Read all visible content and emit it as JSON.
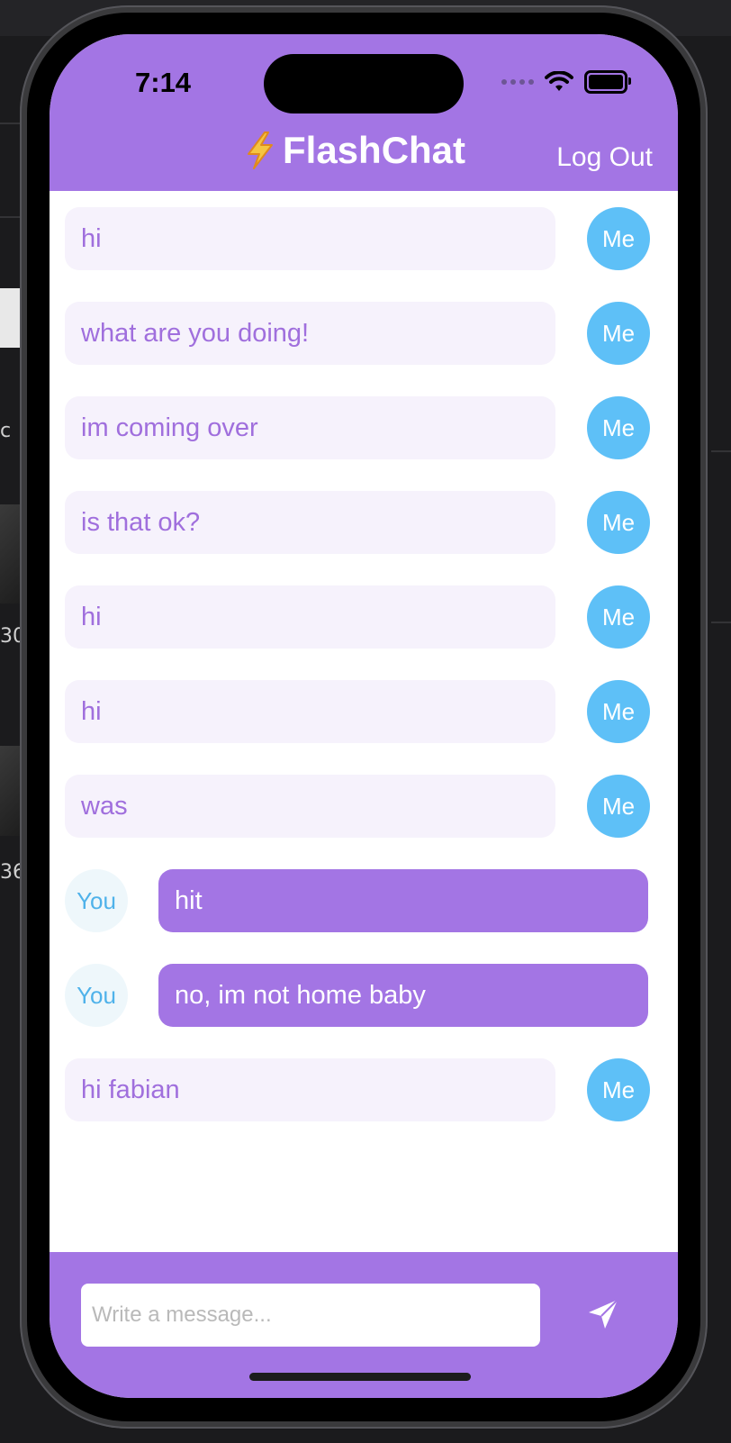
{
  "status_bar": {
    "time": "7:14"
  },
  "header": {
    "title": "FlashChat",
    "logout_label": "Log Out",
    "accent_color": "#a375e4"
  },
  "messages": [
    {
      "sender": "me",
      "text": "hi",
      "avatar": "Me"
    },
    {
      "sender": "me",
      "text": "what are you doing!",
      "avatar": "Me"
    },
    {
      "sender": "me",
      "text": "im coming over",
      "avatar": "Me"
    },
    {
      "sender": "me",
      "text": "is that ok?",
      "avatar": "Me"
    },
    {
      "sender": "me",
      "text": "hi",
      "avatar": "Me"
    },
    {
      "sender": "me",
      "text": "hi",
      "avatar": "Me"
    },
    {
      "sender": "me",
      "text": "was",
      "avatar": "Me"
    },
    {
      "sender": "you",
      "text": "hit",
      "avatar": "You"
    },
    {
      "sender": "you",
      "text": "no, im not home baby",
      "avatar": "You"
    },
    {
      "sender": "me",
      "text": "hi fabian",
      "avatar": "Me"
    }
  ],
  "compose": {
    "placeholder": "Write a message...",
    "value": "",
    "send_icon": "paper-plane-icon"
  },
  "desktop_background": {
    "fragments": [
      "c",
      "30",
      "36"
    ]
  },
  "colors": {
    "me_bubble": "#f6f2fc",
    "me_text": "#a06fdd",
    "me_avatar": "#5ec0f7",
    "you_bubble": "#a375e4",
    "you_avatar": "#eef7fb"
  }
}
